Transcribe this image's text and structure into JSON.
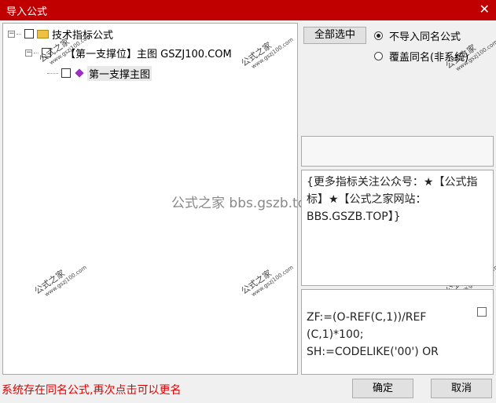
{
  "window": {
    "title": "导入公式",
    "close_glyph": "✕"
  },
  "tree": {
    "root_label": "技术指标公式",
    "expander_minus": "⊟",
    "item_label": "【第一支撑位】主图 GSZJ100.COM",
    "child_label": "第一支撑主图"
  },
  "watermark": {
    "text": "公式之家",
    "url": "www.gszj100.com",
    "center_text": "公式之家 bbs.gszb.top"
  },
  "options": {
    "select_all_label": "全部选中",
    "radio_skip_label": "不导入同名公式",
    "radio_overwrite_label": "覆盖同名(非系统)",
    "selected_option": "skip"
  },
  "description": {
    "text": "{更多指标关注公众号：★【公式指标】★【公式之家网站：BBS.GSZB.TOP】}"
  },
  "formula": {
    "lines": [
      "ZF:=(O-REF(C,1))/REF",
      "(C,1)*100;",
      "SH:=CODELIKE('00') OR"
    ]
  },
  "status_text": "系统存在同名公式,再次点击可以更名",
  "buttons": {
    "ok_label": "确定",
    "cancel_label": "取消"
  },
  "colors": {
    "title_bar": "#c00000",
    "status_text": "#e00000",
    "diamond": "#9b30c0",
    "folder": "#f0c040"
  }
}
